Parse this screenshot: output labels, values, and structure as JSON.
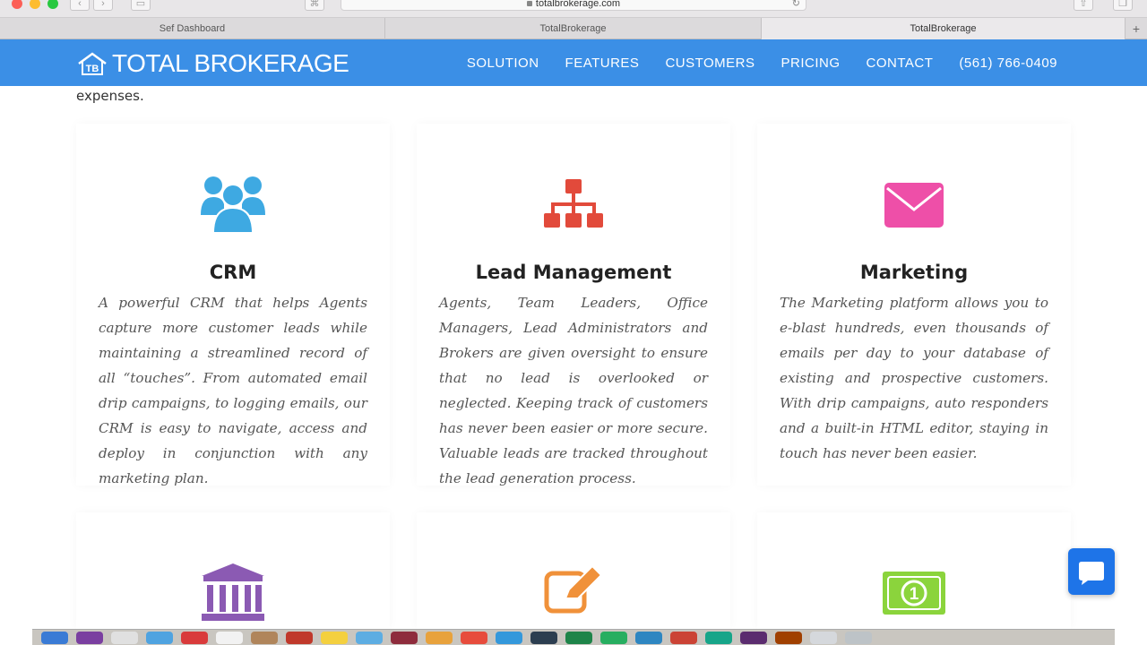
{
  "browser": {
    "url": "totalbrokerage.com",
    "tabs": [
      {
        "label": "Sef Dashboard",
        "active": false
      },
      {
        "label": "TotalBrokerage",
        "active": false
      },
      {
        "label": "TotalBrokerage",
        "active": true
      }
    ]
  },
  "header": {
    "logo_text": "TOTAL BROKERAGE",
    "logo_mark": "TB",
    "nav": [
      "SOLUTION",
      "FEATURES",
      "CUSTOMERS",
      "PRICING",
      "CONTACT",
      "(561) 766-0409"
    ]
  },
  "intro_text": "expenses.",
  "cards": [
    {
      "icon": "users-icon",
      "icon_color": "#3ea9e2",
      "title": "CRM",
      "text": "A powerful CRM that helps Agents capture more customer leads while maintaining a streamlined record of all “touches”. From automated email drip campaigns, to logging emails, our CRM is easy to navigate, access and deploy in conjunction with any marketing plan."
    },
    {
      "icon": "org-chart-icon",
      "icon_color": "#e24a3b",
      "title": "Lead Management",
      "text": "Agents, Team Leaders, Office Managers, Lead Administrators and Brokers are given oversight to ensure that no lead is overlooked or neglected. Keeping track of customers has never been easier or more secure. Valuable leads are tracked throughout the lead generation process."
    },
    {
      "icon": "envelope-icon",
      "icon_color": "#ee4fa8",
      "title": "Marketing",
      "text": "The Marketing platform allows you to e-blast hundreds, even thousands of emails per day to your database of existing and prospective customers. With drip campaigns, auto responders and a built-in HTML editor, staying in touch has never been easier."
    },
    {
      "icon": "bank-icon",
      "icon_color": "#8b5ab3"
    },
    {
      "icon": "edit-icon",
      "icon_color": "#f0913a"
    },
    {
      "icon": "cash-icon",
      "icon_color": "#8bd43c"
    }
  ],
  "colors": {
    "header_bg": "#3b8fe6",
    "chat_button": "#1e74e8"
  }
}
